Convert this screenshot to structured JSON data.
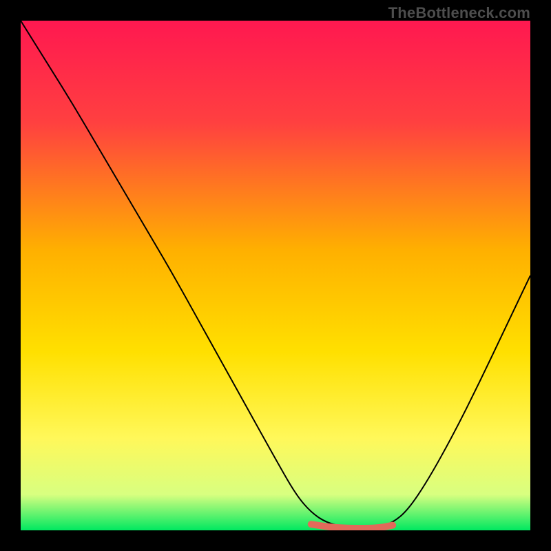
{
  "watermark": "TheBottleneck.com",
  "chart_data": {
    "type": "line",
    "title": "",
    "xlabel": "",
    "ylabel": "",
    "xlim": [
      0,
      1
    ],
    "ylim": [
      0,
      1
    ],
    "grid": false,
    "legend": false,
    "annotations": [],
    "gradient_stops": [
      {
        "pos": 0.0,
        "color": "#ff1850"
      },
      {
        "pos": 0.2,
        "color": "#ff4040"
      },
      {
        "pos": 0.45,
        "color": "#ffb000"
      },
      {
        "pos": 0.65,
        "color": "#ffe000"
      },
      {
        "pos": 0.82,
        "color": "#fff85a"
      },
      {
        "pos": 0.93,
        "color": "#d8ff80"
      },
      {
        "pos": 1.0,
        "color": "#00e860"
      }
    ],
    "series": [
      {
        "name": "bottleneck-curve",
        "color": "#000000",
        "width": 2,
        "x": [
          0.0,
          0.05,
          0.1,
          0.15,
          0.2,
          0.25,
          0.3,
          0.35,
          0.4,
          0.45,
          0.5,
          0.54,
          0.57,
          0.6,
          0.64,
          0.7,
          0.73,
          0.76,
          0.8,
          0.85,
          0.9,
          0.95,
          1.0
        ],
        "y": [
          1.0,
          0.92,
          0.84,
          0.755,
          0.67,
          0.585,
          0.5,
          0.41,
          0.32,
          0.23,
          0.14,
          0.07,
          0.035,
          0.015,
          0.005,
          0.005,
          0.015,
          0.04,
          0.1,
          0.19,
          0.29,
          0.395,
          0.5
        ]
      },
      {
        "name": "highlight-band",
        "color": "#e26a5a",
        "width": 10,
        "x": [
          0.57,
          0.6,
          0.64,
          0.7,
          0.73
        ],
        "y": [
          0.012,
          0.007,
          0.004,
          0.004,
          0.01
        ]
      }
    ]
  }
}
